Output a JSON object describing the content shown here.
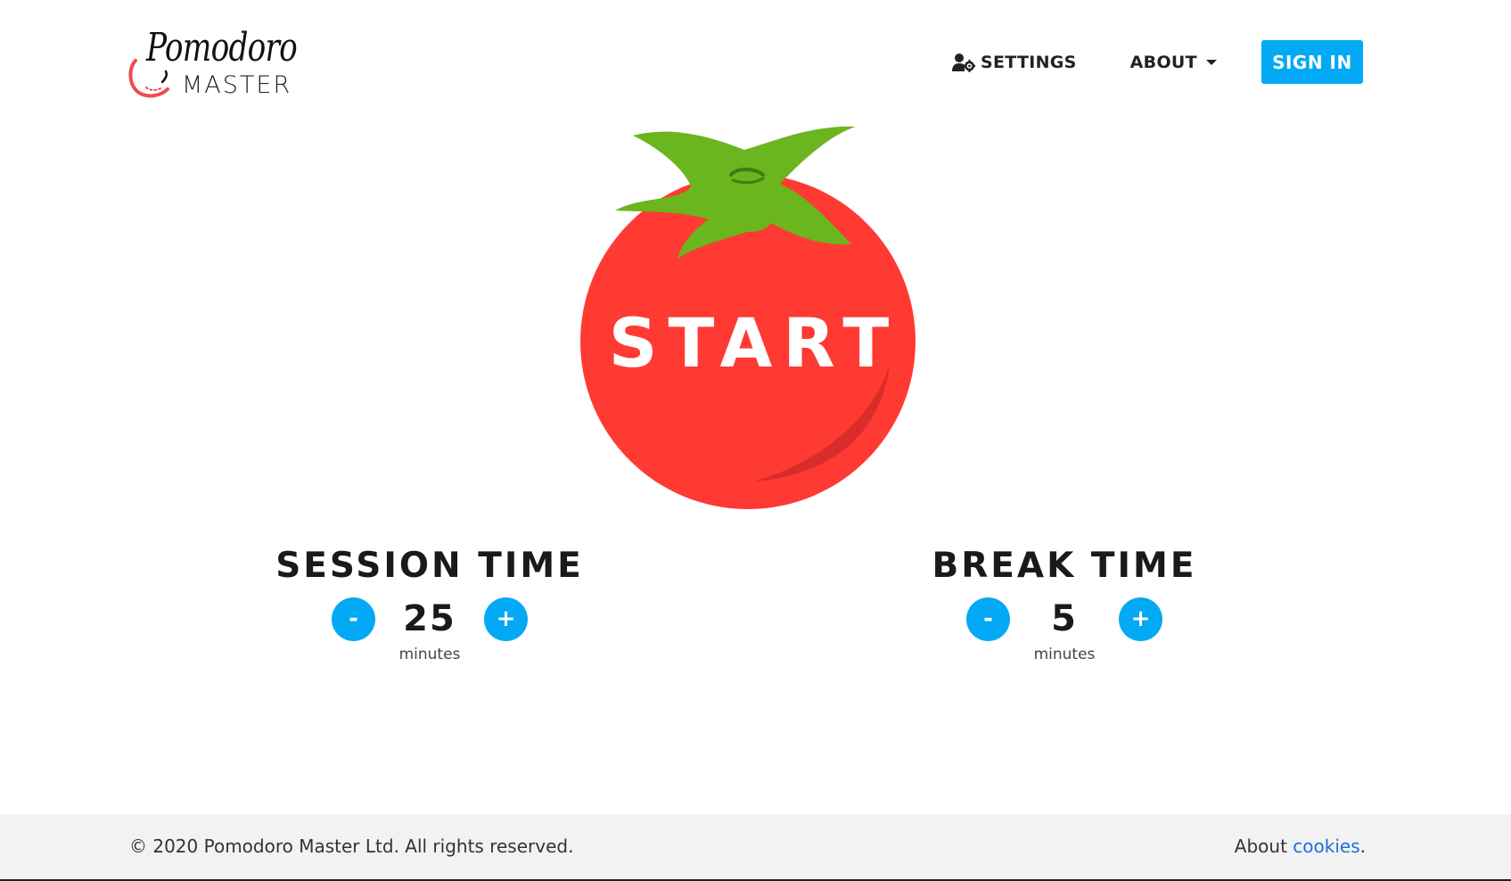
{
  "header": {
    "logo": {
      "top": "Pomodoro",
      "bottom": "MASTER"
    },
    "nav": {
      "settings_label": "SETTINGS",
      "settings_icon": "user-gear-icon",
      "about_label": "ABOUT",
      "about_icon": "caret-down-icon",
      "signin_label": "SIGN IN"
    }
  },
  "main": {
    "start_label": "START",
    "session": {
      "title": "SESSION TIME",
      "value": "25",
      "unit": "minutes",
      "decrement_label": "-",
      "increment_label": "+"
    },
    "break": {
      "title": "BREAK TIME",
      "value": "5",
      "unit": "minutes",
      "decrement_label": "-",
      "increment_label": "+"
    }
  },
  "footer": {
    "copyright": "© 2020 Pomodoro Master Ltd. All rights reserved.",
    "about_prefix": "About ",
    "cookies_link": "cookies",
    "suffix": "."
  },
  "colors": {
    "accent": "#03a9f4",
    "tomato_red": "#ff3a33",
    "tomato_shade": "#d92d2a",
    "leaf_green": "#6bb51e",
    "link_blue": "#1e6fd9",
    "footer_bg": "#f2f2f2"
  }
}
